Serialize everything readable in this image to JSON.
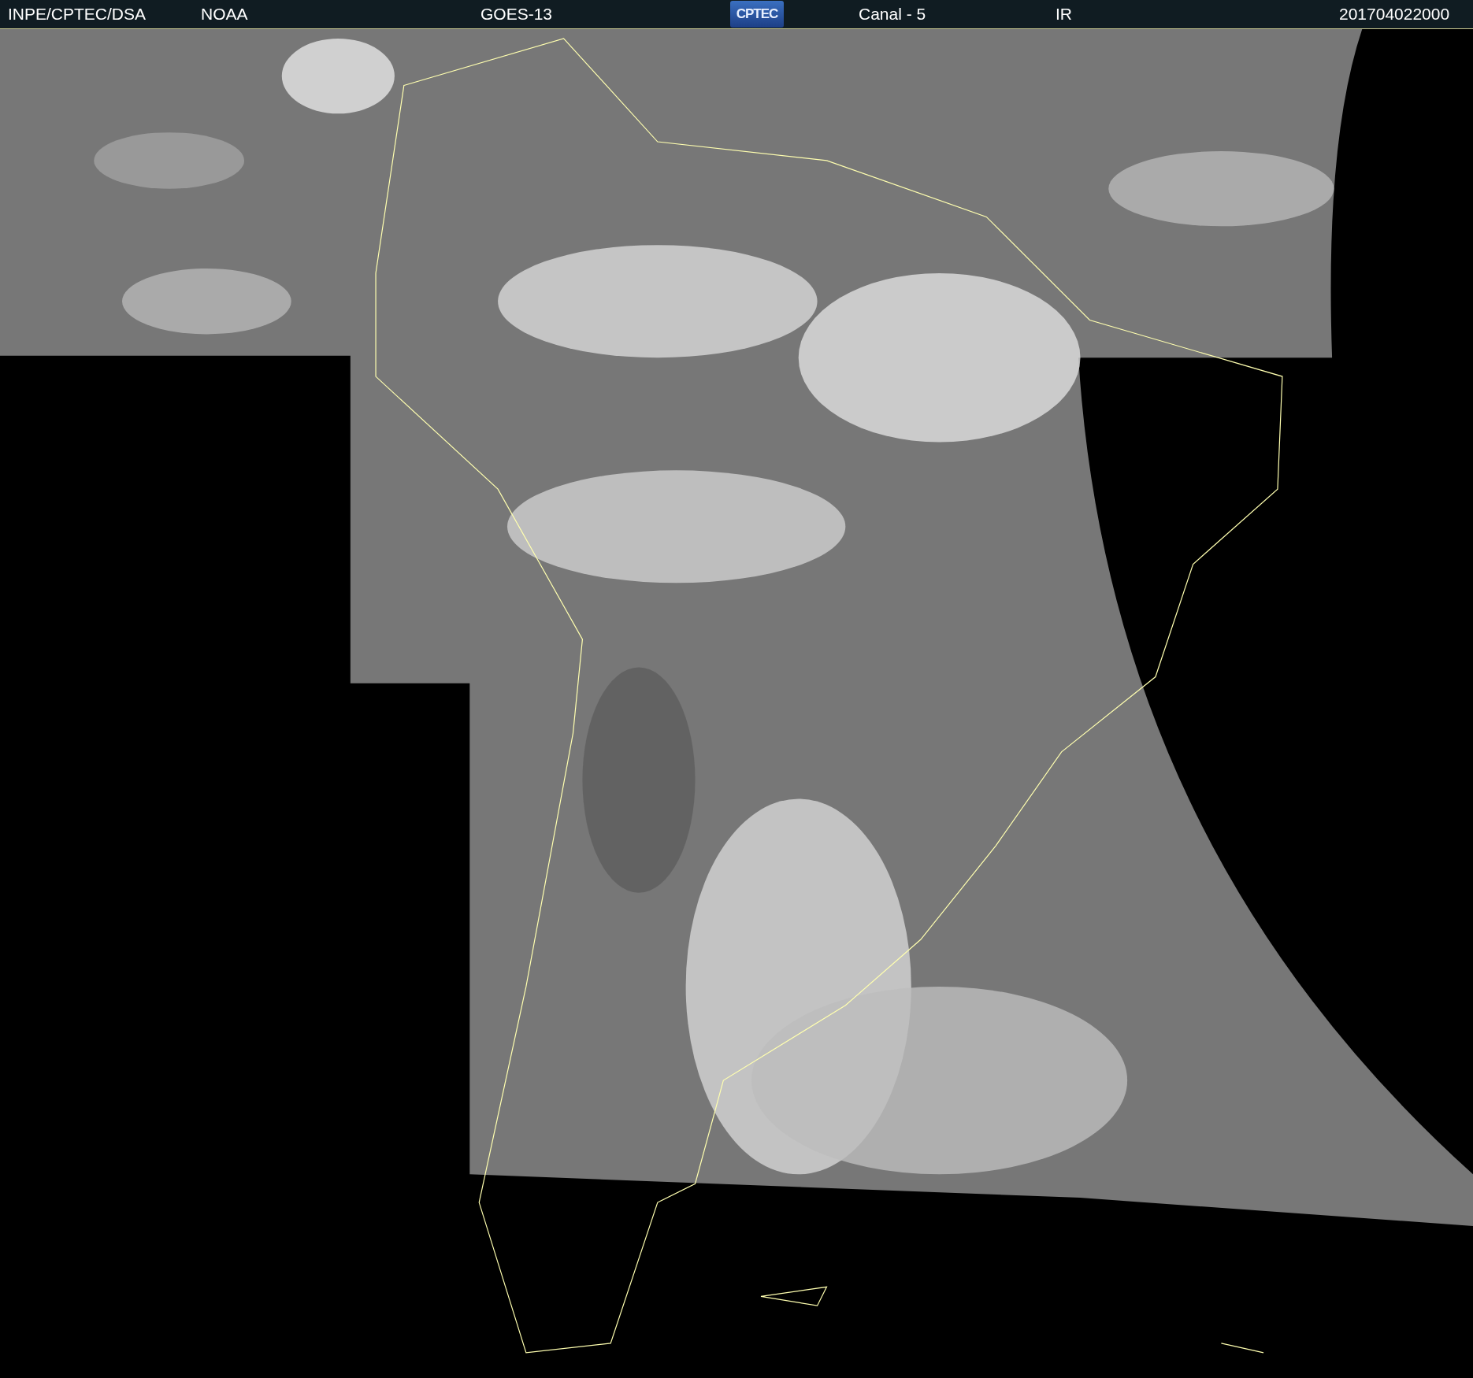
{
  "header": {
    "source": "INPE/CPTEC/DSA",
    "agency": "NOAA",
    "satellite": "GOES-13",
    "logo": "CPTEC",
    "channel": "Canal - 5",
    "band": "IR",
    "timestamp": "201704022000"
  }
}
